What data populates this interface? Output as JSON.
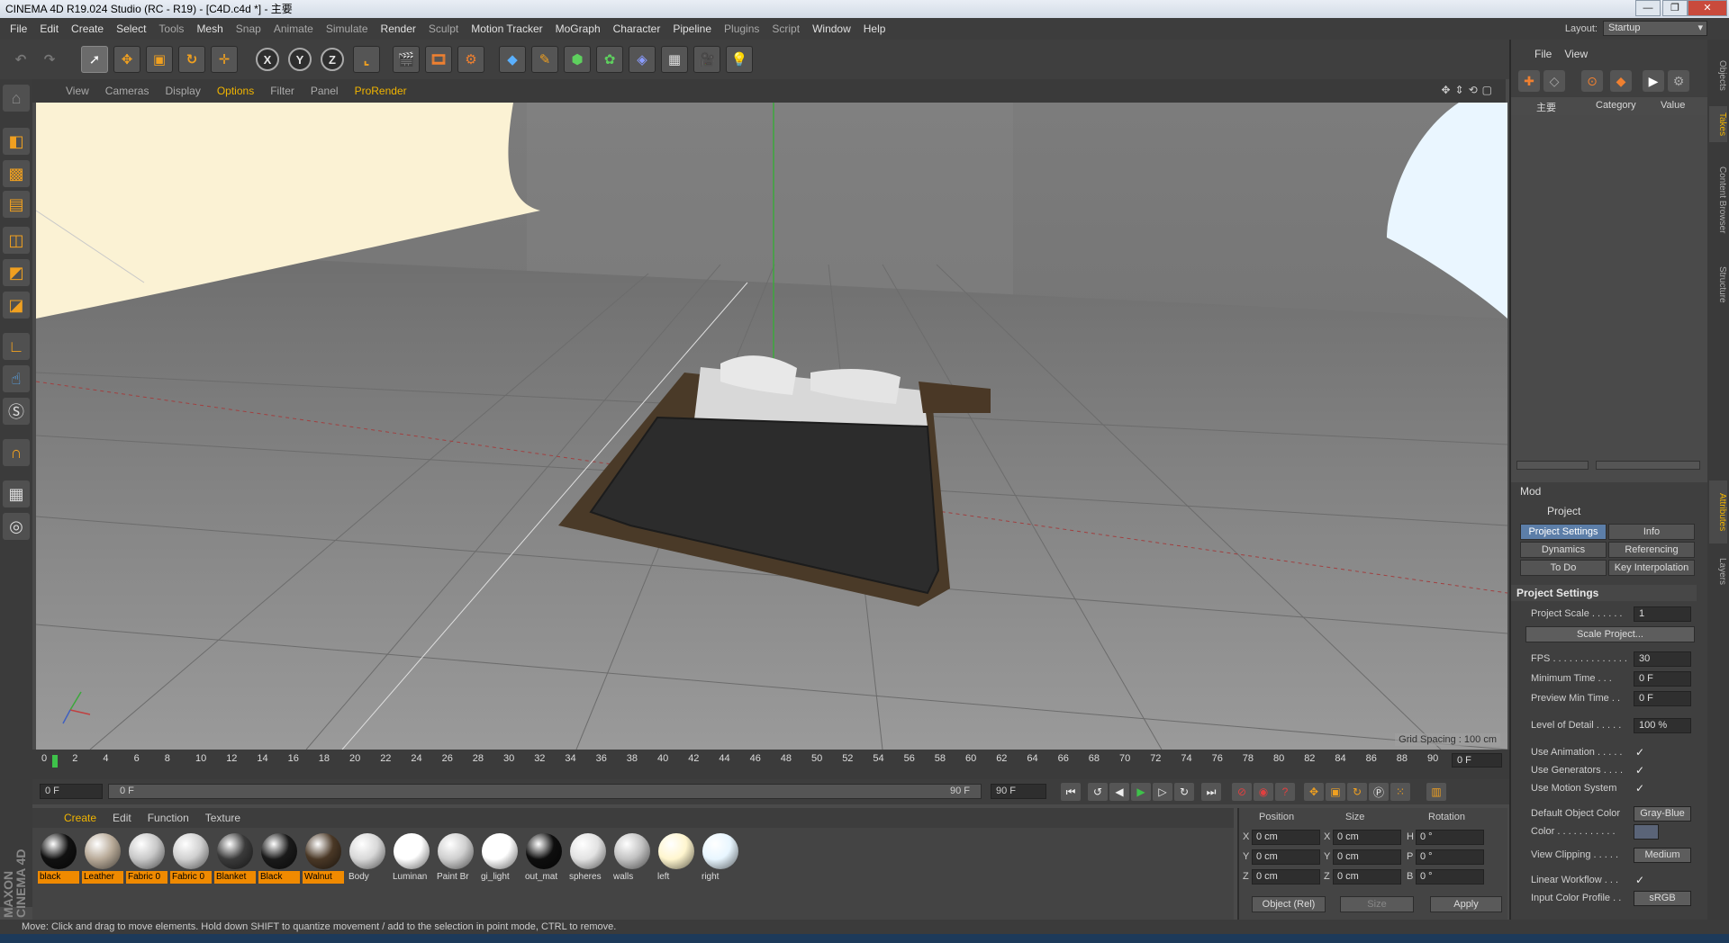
{
  "window": {
    "title": "CINEMA 4D R19.024 Studio (RC - R19) - [C4D.c4d *] - 主要"
  },
  "menu": [
    "File",
    "Edit",
    "Create",
    "Select",
    "Tools",
    "Mesh",
    "Snap",
    "Animate",
    "Simulate",
    "Render",
    "Sculpt",
    "Motion Tracker",
    "MoGraph",
    "Character",
    "Pipeline",
    "Plugins",
    "Script",
    "Window",
    "Help"
  ],
  "layout": {
    "label": "Layout:",
    "value": "Startup"
  },
  "toolbar": {
    "axis_x": "X",
    "axis_y": "Y",
    "axis_z": "Z"
  },
  "viewport": {
    "menu": [
      "View",
      "Cameras",
      "Display",
      "Options",
      "Filter",
      "Panel",
      "ProRender"
    ],
    "grid_spacing": "Grid Spacing : 100 cm"
  },
  "objects": {
    "menu": [
      "File",
      "View"
    ],
    "root_name": "主要",
    "col_category": "Category",
    "col_value": "Value"
  },
  "attributes": {
    "mode": "Mod",
    "object": "Project",
    "tabs": [
      "Project Settings",
      "Info",
      "Dynamics",
      "Referencing",
      "To Do",
      "Key Interpolation"
    ],
    "section": "Project Settings",
    "project_scale_label": "Project Scale . . . . . .",
    "project_scale": "1",
    "scale_button": "Scale Project...",
    "fps_label": "FPS . . . . . . . . . . . . . .",
    "fps": "30",
    "min_time_label": "Minimum Time . . .",
    "min_time": "0 F",
    "preview_min_label": "Preview Min Time . .",
    "preview_min": "0 F",
    "lod_label": "Level of Detail . . . . .",
    "lod": "100 %",
    "use_anim_label": "Use Animation . . . . .",
    "use_gen_label": "Use Generators . . . .",
    "use_motion_label": "Use Motion System",
    "default_color_label": "Default Object Color",
    "default_color": "Gray-Blue",
    "color_label": "Color . . . . . . . . . . .",
    "view_clipping_label": "View Clipping . . . . .",
    "view_clipping": "Medium",
    "linear_wf_label": "Linear Workflow . . .",
    "input_profile_label": "Input Color Profile . .",
    "input_profile": "sRGB",
    "check": "✓"
  },
  "timeline": {
    "ticks": [
      "0",
      "2",
      "4",
      "6",
      "8",
      "10",
      "12",
      "14",
      "16",
      "18",
      "20",
      "22",
      "24",
      "26",
      "28",
      "30",
      "32",
      "34",
      "36",
      "38",
      "40",
      "42",
      "44",
      "46",
      "48",
      "50",
      "52",
      "54",
      "56",
      "58",
      "60",
      "62",
      "64",
      "66",
      "68",
      "70",
      "72",
      "74",
      "76",
      "78",
      "80",
      "82",
      "84",
      "86",
      "88",
      "90"
    ],
    "current": "0 F",
    "start": "0 F",
    "range_start": "0 F",
    "range_end": "90 F",
    "end": "90 F"
  },
  "materials": {
    "menu": [
      "Create",
      "Edit",
      "Function",
      "Texture"
    ],
    "items": [
      {
        "name": "black",
        "color": "#111111",
        "sel": true
      },
      {
        "name": "Leather",
        "color": "#b8aa98",
        "sel": true
      },
      {
        "name": "Fabric 0",
        "color": "#c8c8c8",
        "sel": true
      },
      {
        "name": "Fabric 0",
        "color": "#d0d0d0",
        "sel": true
      },
      {
        "name": "Blanket",
        "color": "#3a3a3a",
        "sel": true
      },
      {
        "name": "Black",
        "color": "#1a1a1a",
        "sel": true
      },
      {
        "name": "Walnut",
        "color": "#4a3826",
        "sel": true
      },
      {
        "name": "Body",
        "color": "#d8d8d8",
        "sel": false
      },
      {
        "name": "Luminan",
        "color": "#ffffff",
        "sel": false
      },
      {
        "name": "Paint Br",
        "color": "#cfcfcf",
        "sel": false
      },
      {
        "name": "gi_light",
        "color": "#ffffff",
        "sel": false
      },
      {
        "name": "out_mat",
        "color": "#0e0e0e",
        "sel": false
      },
      {
        "name": "spheres",
        "color": "#e2e2e2",
        "sel": false
      },
      {
        "name": "walls",
        "color": "#c2c2c2",
        "sel": false
      },
      {
        "name": "left",
        "color": "#fff6cf",
        "sel": false
      },
      {
        "name": "right",
        "color": "#e8f6ff",
        "sel": false
      }
    ]
  },
  "coordinates": {
    "position": "Position",
    "size": "Size",
    "rotation": "Rotation",
    "x": "X",
    "y": "Y",
    "z": "Z",
    "h": "H",
    "p": "P",
    "b": "B",
    "pos_x": "0 cm",
    "pos_y": "0 cm",
    "pos_z": "0 cm",
    "size_x": "0 cm",
    "size_y": "0 cm",
    "size_z": "0 cm",
    "rot_h": "0 °",
    "rot_p": "0 °",
    "rot_b": "0 °",
    "mode": "Object (Rel)",
    "size_mode": "Size",
    "apply": "Apply"
  },
  "side_tabs": [
    "Objects",
    "Takes",
    "Content Browser",
    "Structure",
    "Attributes",
    "Layers"
  ],
  "status": "Move: Click and drag to move elements. Hold down SHIFT to quantize movement / add to the selection in point mode, CTRL to remove.",
  "brand": "MAXON CINEMA 4D",
  "colors": {
    "accent": "#f0b400",
    "selected_tab": "#5c7ea8",
    "material_label": "#f08a00"
  }
}
